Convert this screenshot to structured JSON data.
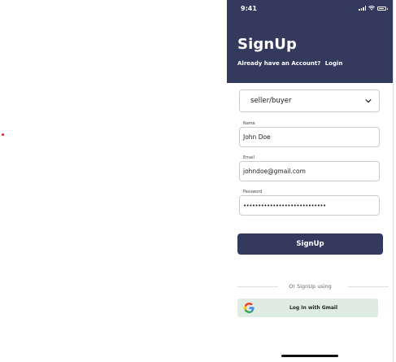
{
  "status_bar": {
    "time": "9:41"
  },
  "header": {
    "title": "SignUp",
    "prompt": "Already have an Account?",
    "login_link": "Login"
  },
  "form": {
    "role_select": {
      "value": "seller/buyer"
    },
    "name": {
      "label": "Name",
      "value": "John Doe"
    },
    "email": {
      "label": "Email",
      "value": "johndoe@gmail.com"
    },
    "password": {
      "label": "Password",
      "value": "••••••••••••••••••••••••••••"
    },
    "submit_label": "SignUp"
  },
  "alt_signup": {
    "divider_text": "Or SignUp using",
    "gmail_label": "Log In with Gmail"
  },
  "colors": {
    "primary": "#333a5e",
    "gmail_button_bg": "#deece4"
  }
}
